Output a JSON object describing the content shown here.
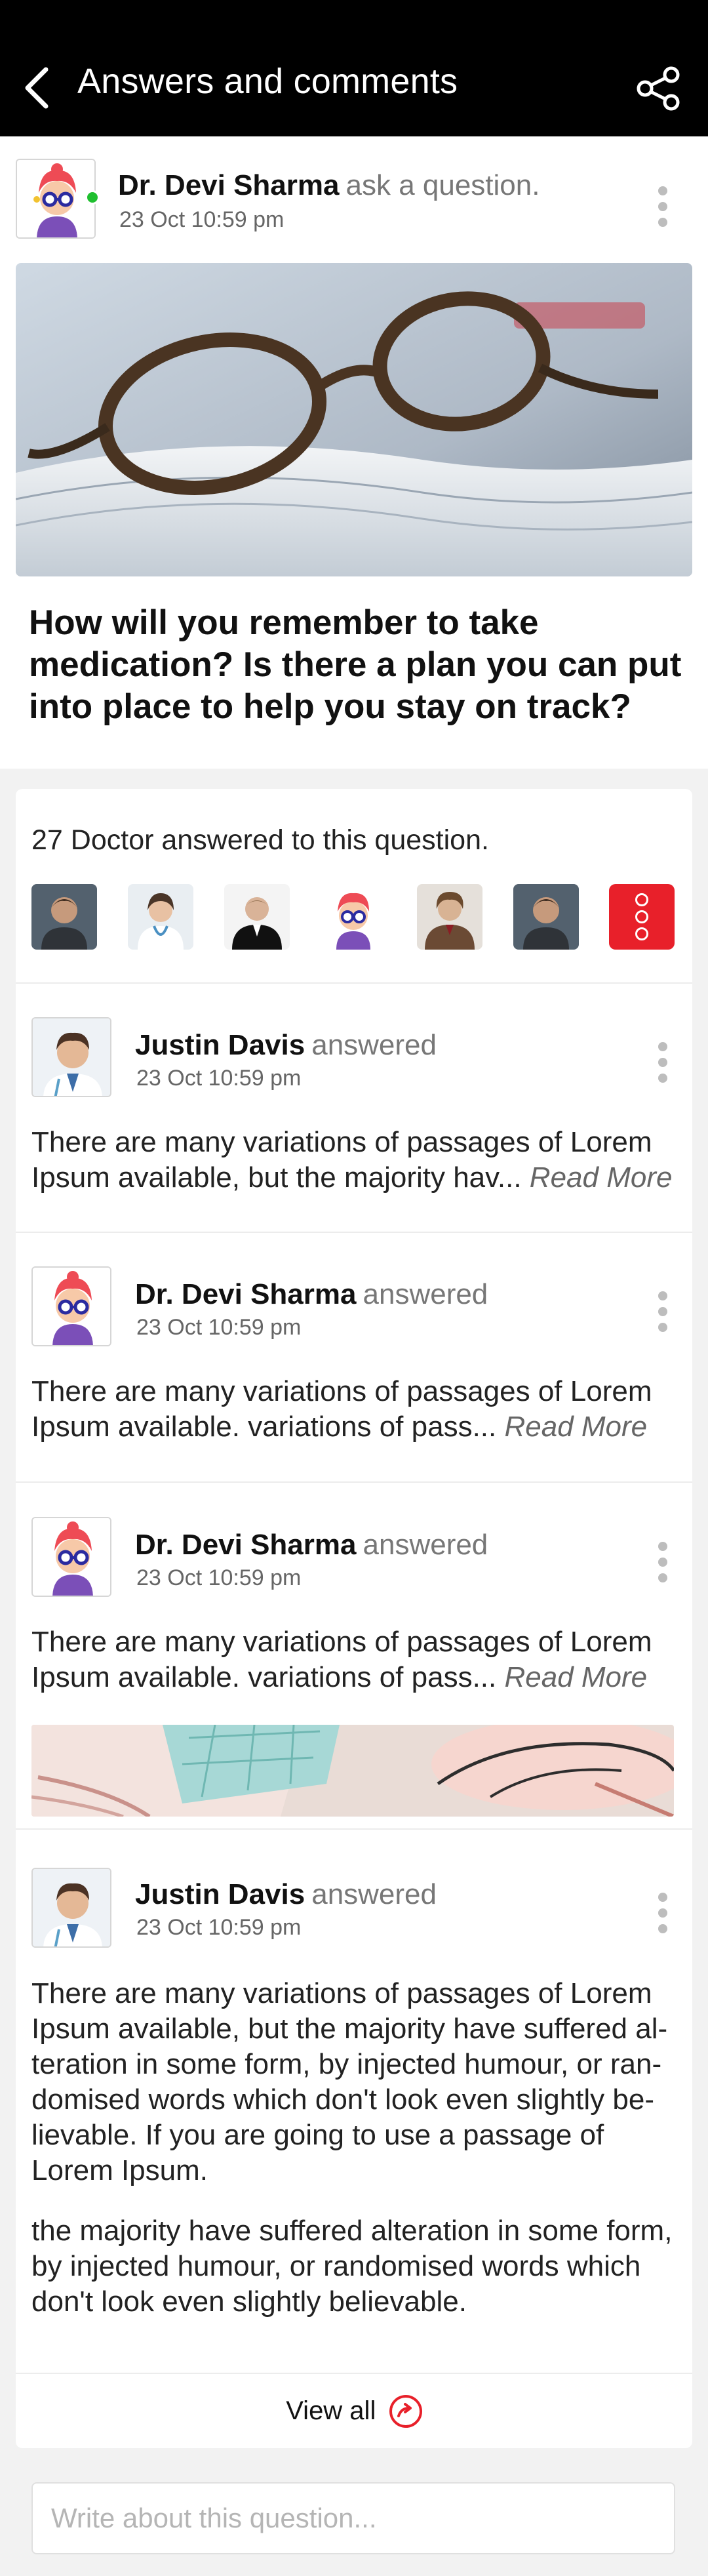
{
  "header": {
    "title": "Answers and comments",
    "back_icon": "chevron-left-icon",
    "share_icon": "share-icon"
  },
  "post": {
    "author": "Dr. Devi Sharma",
    "action": "ask a question.",
    "date": "23 Oct 10:59 pm",
    "online": true,
    "question": "How will you remember to take medication? Is there a plan you can put into place to help you stay on track?"
  },
  "answers_summary": {
    "count_text": "27 Doctor answered to this question."
  },
  "answers": [
    {
      "author": "Justin Davis",
      "action": "answered",
      "date": "23 Oct 10:59 pm",
      "text": "There are many variations of passages of Lorem Ipsum available, but the majority hav...",
      "read_more": "Read More"
    },
    {
      "author": "Dr. Devi Sharma",
      "action": "answered",
      "date": "23 Oct 10:59 pm",
      "text": "There are many variations of passages of Lorem Ipsum available. variations of pass...",
      "read_more": "Read More"
    },
    {
      "author": "Dr. Devi Sharma",
      "action": "answered",
      "date": "23 Oct 10:59 pm",
      "text": "There are many variations of passages of Lorem Ipsum available. variations of pass...",
      "read_more": "Read More"
    },
    {
      "author": "Justin Davis",
      "action": "answered",
      "date": "23 Oct 10:59 pm",
      "paragraph1": "There are many variations of passages of Lorem Ipsum available, but the majority have suffered al-teration in some form, by injected humour, or ran-domised words which don't look even slightly be-lievable. If you are going to use a passage of Lorem Ipsum.",
      "paragraph2": "the majority have suffered alteration in some form, by injected humour, or randomised words which don't look even slightly believable."
    }
  ],
  "footer": {
    "view_all": "View all",
    "compose_placeholder": "Write about this question..."
  },
  "colors": {
    "accent": "#e8202a",
    "header_bg": "#000000",
    "online": "#1fbf2f"
  }
}
